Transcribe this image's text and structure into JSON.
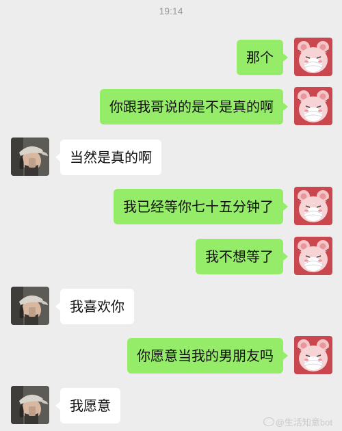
{
  "status_bar": {
    "time": "19:14"
  },
  "colors": {
    "background": "#ededed",
    "sent_bubble": "#95ec69",
    "received_bubble": "#ffffff",
    "timestamp": "#9a9a9a"
  },
  "messages": [
    {
      "sender": "me",
      "text": "那个",
      "avatar": "pink-bear-avatar-icon"
    },
    {
      "sender": "me",
      "text": "你跟我哥说的是不是真的啊",
      "avatar": "pink-bear-avatar-icon"
    },
    {
      "sender": "other",
      "text": "当然是真的啊",
      "avatar": "boy-with-cap-avatar-icon"
    },
    {
      "sender": "me",
      "text": "我已经等你七十五分钟了",
      "avatar": "pink-bear-avatar-icon"
    },
    {
      "sender": "me",
      "text": "我不想等了",
      "avatar": "pink-bear-avatar-icon"
    },
    {
      "sender": "other",
      "text": "我喜欢你",
      "avatar": "boy-with-cap-avatar-icon"
    },
    {
      "sender": "me",
      "text": "你愿意当我的男朋友吗",
      "avatar": "pink-bear-avatar-icon"
    },
    {
      "sender": "other",
      "text": "我愿意",
      "avatar": "boy-with-cap-avatar-icon"
    }
  ],
  "watermark": {
    "text": "@生活知意bot"
  }
}
